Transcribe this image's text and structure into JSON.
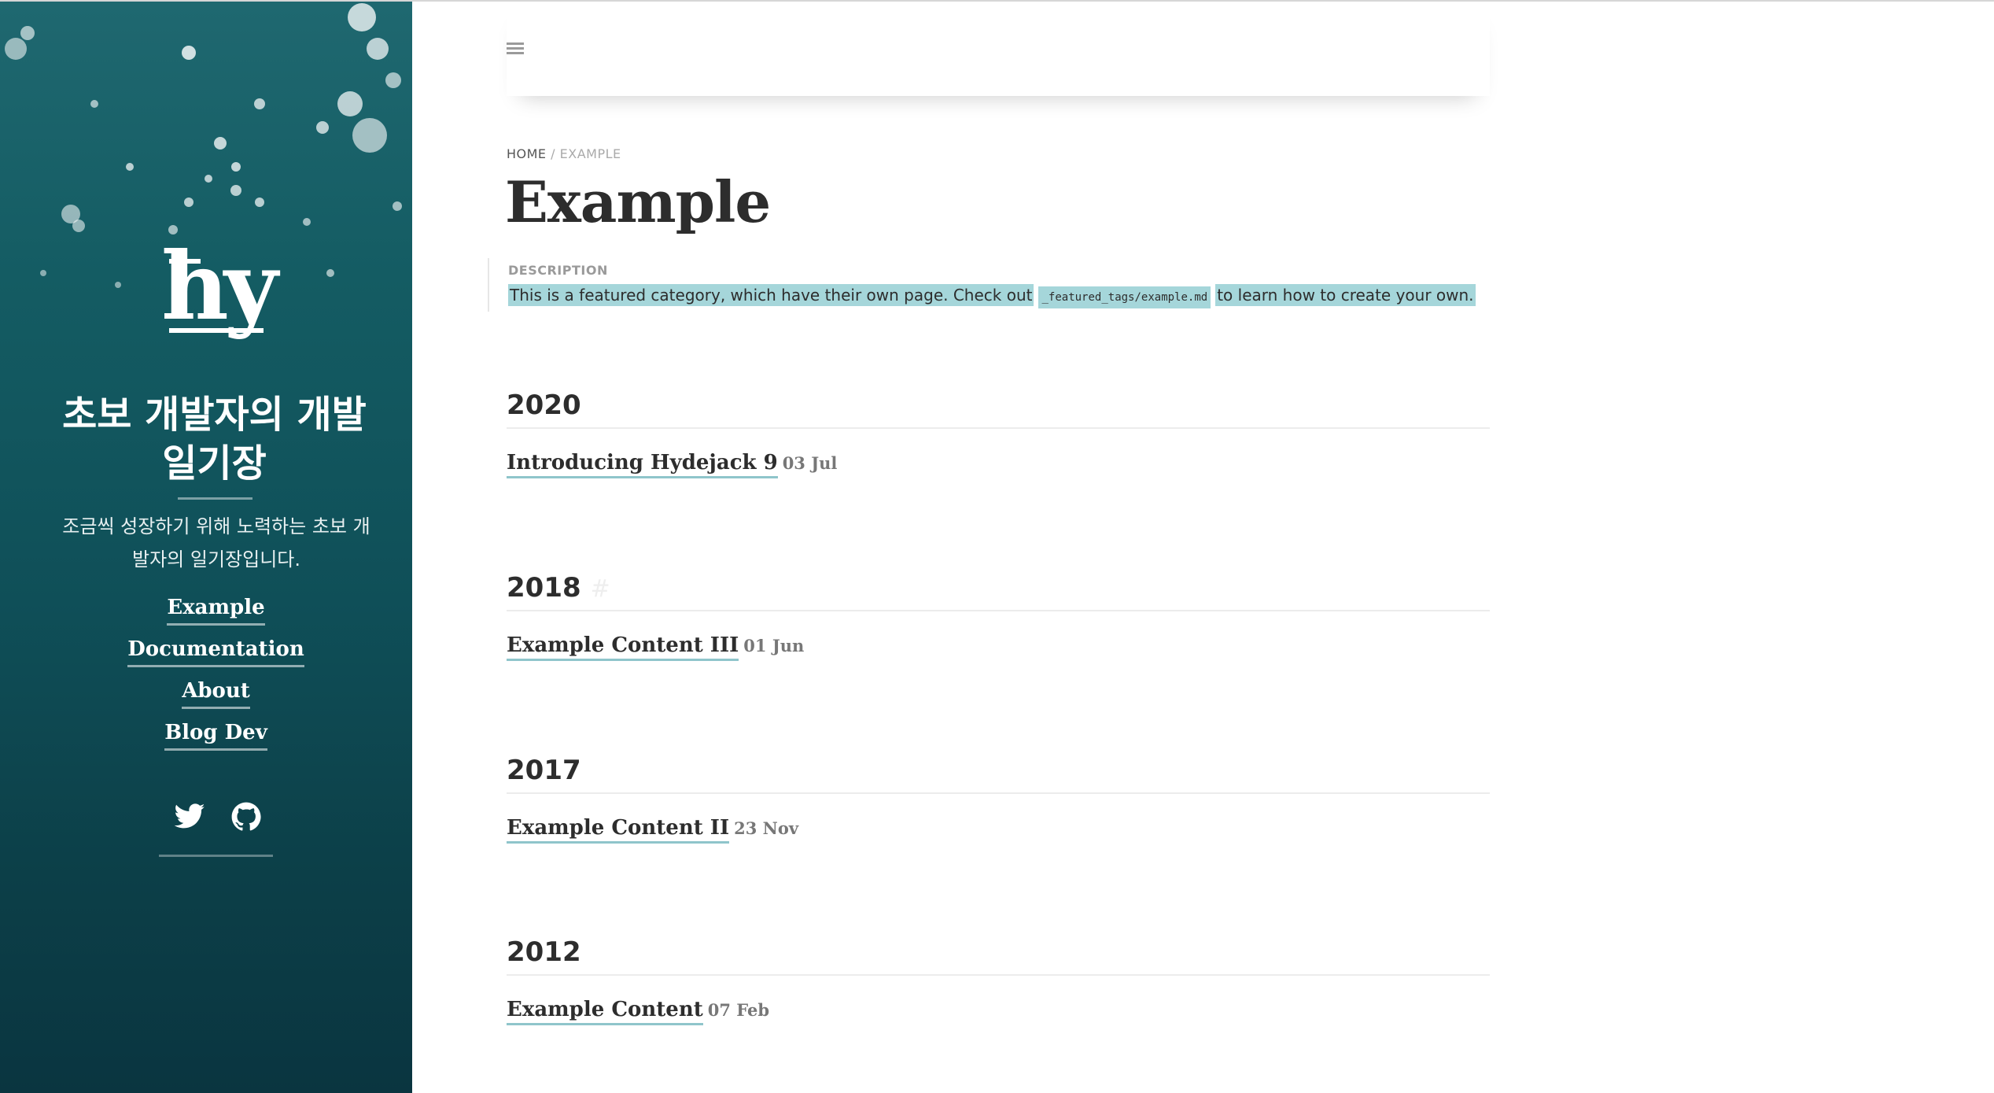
{
  "sidebar": {
    "logo_text": "hy",
    "title": "초보 개발자의 개발 일기장",
    "description": "조금씩 성장하기 위해 노력하는 초보 개발자의 일기장입니다.",
    "nav": [
      {
        "label": "Example"
      },
      {
        "label": "Documentation"
      },
      {
        "label": "About"
      },
      {
        "label": "Blog Dev"
      }
    ],
    "social": [
      {
        "icon": "twitter-icon"
      },
      {
        "icon": "github-icon"
      }
    ],
    "colors": {
      "background": "#145c63",
      "text": "#ffffff"
    }
  },
  "navbar": {
    "menu_icon": "menu-icon"
  },
  "breadcrumb": {
    "home": "HOME",
    "separator": "/",
    "current": "EXAMPLE"
  },
  "page": {
    "title": "Example",
    "description_label": "DESCRIPTION",
    "description_before": "This is a featured category, which have their own page. Check out",
    "description_code": "_featured_tags/example.md",
    "description_after": "to learn how to create your own.",
    "highlight_color": "#a5d6da"
  },
  "years": [
    {
      "year": "2020",
      "posts": [
        {
          "title": "Introducing Hydejack 9",
          "date": "03 Jul"
        }
      ]
    },
    {
      "year": "2018",
      "anchor": "#",
      "posts": [
        {
          "title": "Example Content III",
          "date": "01 Jun"
        }
      ]
    },
    {
      "year": "2017",
      "posts": [
        {
          "title": "Example Content II",
          "date": "23 Nov"
        }
      ]
    },
    {
      "year": "2012",
      "posts": [
        {
          "title": "Example Content",
          "date": "07 Feb"
        }
      ]
    }
  ],
  "accent_color": "#8fc5cb"
}
